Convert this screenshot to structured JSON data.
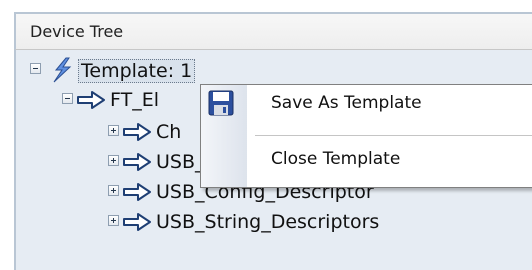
{
  "panel": {
    "title": "Device Tree"
  },
  "tree": {
    "root": {
      "label": "Template: 1",
      "icon": "lightning-bolt-icon",
      "expanded": true,
      "selected": true
    },
    "child": {
      "label": "FT_El",
      "icon": "arrow-icon",
      "expanded": true
    },
    "items": [
      {
        "label": "Ch"
      },
      {
        "label": "USB_Device_Descriptor"
      },
      {
        "label": "USB_Config_Descriptor"
      },
      {
        "label": "USB_String_Descriptors"
      }
    ]
  },
  "context_menu": {
    "items": [
      {
        "label": "Save As Template",
        "icon": "floppy-disk-icon"
      },
      {
        "label": "Close Template"
      }
    ]
  },
  "colors": {
    "tree_background": "#e6ecf3",
    "arrow_fill": "#1f3f74",
    "menu_border": "#808080"
  }
}
